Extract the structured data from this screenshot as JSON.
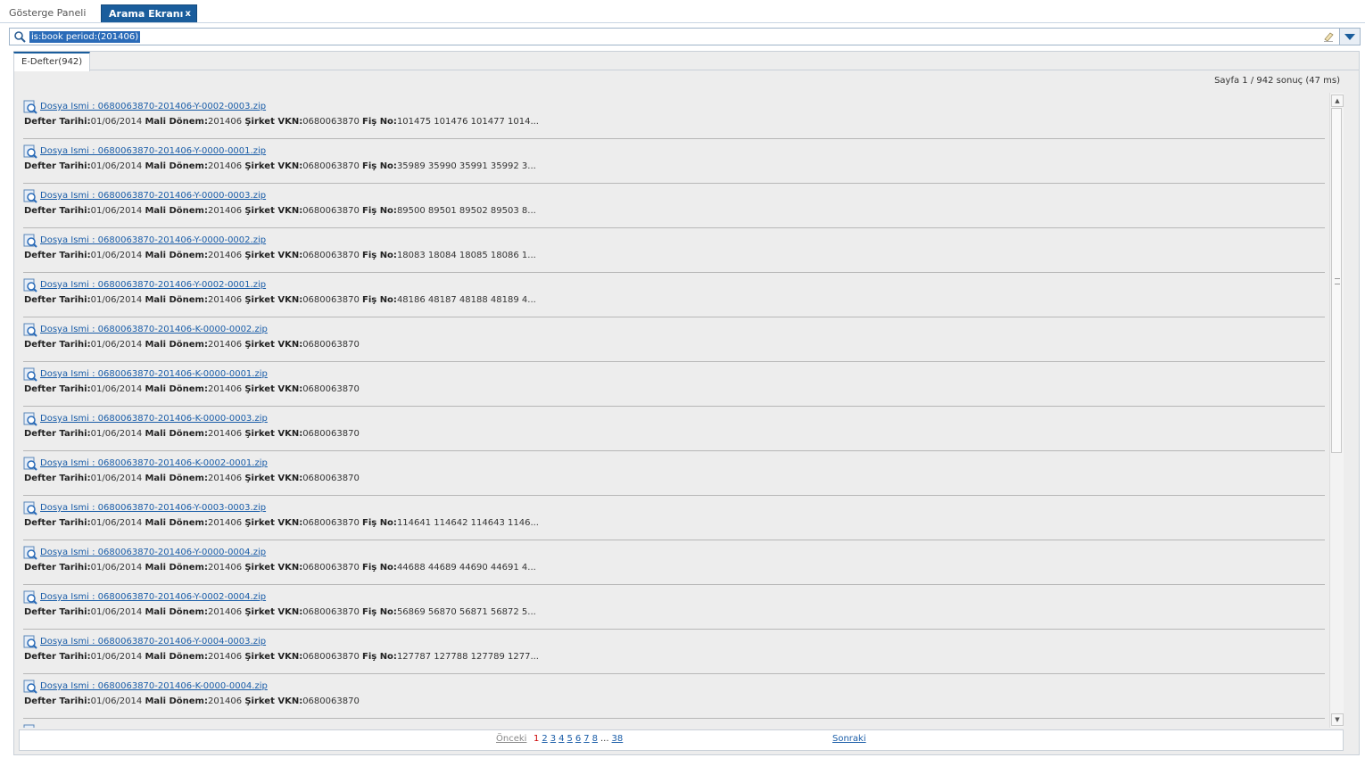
{
  "tabs": [
    {
      "label": "Gösterge Paneli",
      "active": false
    },
    {
      "label": "Arama Ekranı",
      "active": true,
      "close": "x"
    }
  ],
  "search": {
    "query": "is:book period:(201406)"
  },
  "result_tab": {
    "label": "E-Defter(942)"
  },
  "summary": "Sayfa 1 / 942 sonuç (47 ms)",
  "labels": {
    "defter_tarihi": "Defter Tarihi:",
    "mali_donem": "Mali Dönem:",
    "sirket_vkn": "Şirket VKN:",
    "fis_no": "Fiş No:"
  },
  "results": [
    {
      "file": "Dosya Ismi : 0680063870-201406-Y-0002-0003.zip",
      "date": "01/06/2014",
      "period": "201406",
      "vkn": "0680063870",
      "fis": "101475 101476 101477 1014..."
    },
    {
      "file": "Dosya Ismi : 0680063870-201406-Y-0000-0001.zip",
      "date": "01/06/2014",
      "period": "201406",
      "vkn": "0680063870",
      "fis": "35989 35990 35991 35992 3..."
    },
    {
      "file": "Dosya Ismi : 0680063870-201406-Y-0000-0003.zip",
      "date": "01/06/2014",
      "period": "201406",
      "vkn": "0680063870",
      "fis": "89500 89501 89502 89503 8..."
    },
    {
      "file": "Dosya Ismi : 0680063870-201406-Y-0000-0002.zip",
      "date": "01/06/2014",
      "period": "201406",
      "vkn": "0680063870",
      "fis": "18083 18084 18085 18086 1..."
    },
    {
      "file": "Dosya Ismi : 0680063870-201406-Y-0002-0001.zip",
      "date": "01/06/2014",
      "period": "201406",
      "vkn": "0680063870",
      "fis": "48186 48187 48188 48189 4..."
    },
    {
      "file": "Dosya Ismi : 0680063870-201406-K-0000-0002.zip",
      "date": "01/06/2014",
      "period": "201406",
      "vkn": "0680063870",
      "fis": ""
    },
    {
      "file": "Dosya Ismi : 0680063870-201406-K-0000-0001.zip",
      "date": "01/06/2014",
      "period": "201406",
      "vkn": "0680063870",
      "fis": ""
    },
    {
      "file": "Dosya Ismi : 0680063870-201406-K-0000-0003.zip",
      "date": "01/06/2014",
      "period": "201406",
      "vkn": "0680063870",
      "fis": ""
    },
    {
      "file": "Dosya Ismi : 0680063870-201406-K-0002-0001.zip",
      "date": "01/06/2014",
      "period": "201406",
      "vkn": "0680063870",
      "fis": ""
    },
    {
      "file": "Dosya Ismi : 0680063870-201406-Y-0003-0003.zip",
      "date": "01/06/2014",
      "period": "201406",
      "vkn": "0680063870",
      "fis": "114641 114642 114643 1146..."
    },
    {
      "file": "Dosya Ismi : 0680063870-201406-Y-0000-0004.zip",
      "date": "01/06/2014",
      "period": "201406",
      "vkn": "0680063870",
      "fis": "44688 44689 44690 44691 4..."
    },
    {
      "file": "Dosya Ismi : 0680063870-201406-Y-0002-0004.zip",
      "date": "01/06/2014",
      "period": "201406",
      "vkn": "0680063870",
      "fis": "56869 56870 56871 56872 5..."
    },
    {
      "file": "Dosya Ismi : 0680063870-201406-Y-0004-0003.zip",
      "date": "01/06/2014",
      "period": "201406",
      "vkn": "0680063870",
      "fis": "127787 127788 127789 1277..."
    },
    {
      "file": "Dosya Ismi : 0680063870-201406-K-0000-0004.zip",
      "date": "01/06/2014",
      "period": "201406",
      "vkn": "0680063870",
      "fis": ""
    }
  ],
  "pager": {
    "prev": "Önceki",
    "current": "1",
    "pages": [
      "2",
      "3",
      "4",
      "5",
      "6",
      "7",
      "8"
    ],
    "ellipsis": "...",
    "last": "38",
    "next": "Sonraki"
  },
  "colors": {
    "accent": "#1a5d9c",
    "link": "#1a5da8",
    "current_page": "#cc0000"
  }
}
